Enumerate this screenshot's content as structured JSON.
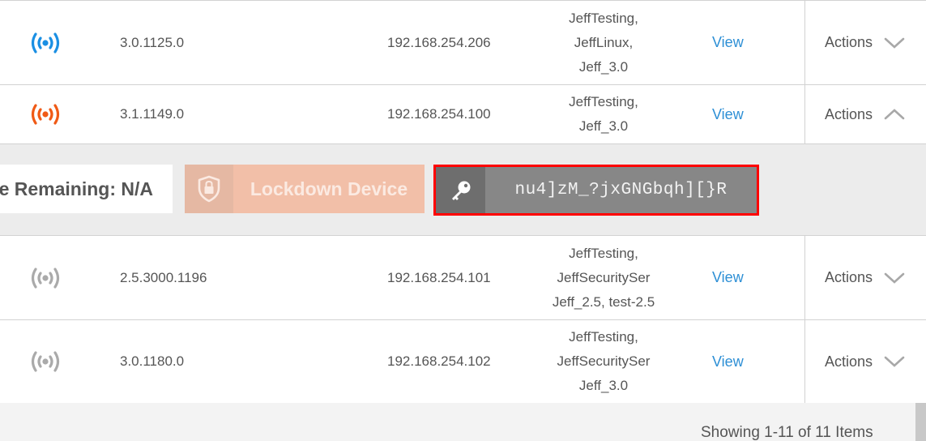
{
  "colors": {
    "status_online": "#1a8fe3",
    "status_warning": "#f05a16",
    "status_offline": "#aaaaaa",
    "link": "#2d8fd5",
    "highlight_border": "#ff0000"
  },
  "rows": [
    {
      "status_icon": "broadcast-icon",
      "status": "online",
      "version": "3.0.1125.0",
      "ip": "192.168.254.206",
      "groups": [
        "JeffTesting,",
        "JeffLinux,",
        "Jeff_3.0"
      ],
      "view_label": "View",
      "actions_label": "Actions",
      "actions_icon": "chevron-down-icon"
    },
    {
      "status_icon": "broadcast-icon",
      "status": "warning",
      "version": "3.1.1149.0",
      "ip": "192.168.254.100",
      "groups": [
        "JeffTesting,",
        "Jeff_3.0"
      ],
      "view_label": "View",
      "actions_label": "Actions",
      "actions_icon": "chevron-up-icon"
    },
    {
      "status_icon": "broadcast-icon",
      "status": "offline",
      "version": "2.5.3000.1196",
      "ip": "192.168.254.101",
      "groups": [
        "JeffTesting,",
        "JeffSecuritySer",
        "Jeff_2.5, test-2.5"
      ],
      "view_label": "View",
      "actions_label": "Actions",
      "actions_icon": "chevron-down-icon"
    },
    {
      "status_icon": "broadcast-icon",
      "status": "offline",
      "version": "3.0.1180.0",
      "ip": "192.168.254.102",
      "groups": [
        "JeffTesting,",
        "JeffSecuritySer",
        "Jeff_3.0"
      ],
      "view_label": "View",
      "actions_label": "Actions",
      "actions_icon": "chevron-down-icon"
    }
  ],
  "expanded_panel": {
    "remaining_text": "Time Remaining: N/A",
    "lockdown": {
      "icon": "shield-lock-icon",
      "label": "Lockdown Device"
    },
    "password": {
      "icon": "key-icon",
      "value": "nu4]zM_?jxGNGbqh][}R"
    }
  },
  "footer": {
    "showing_text": "Showing 1-11 of 11 Items"
  }
}
